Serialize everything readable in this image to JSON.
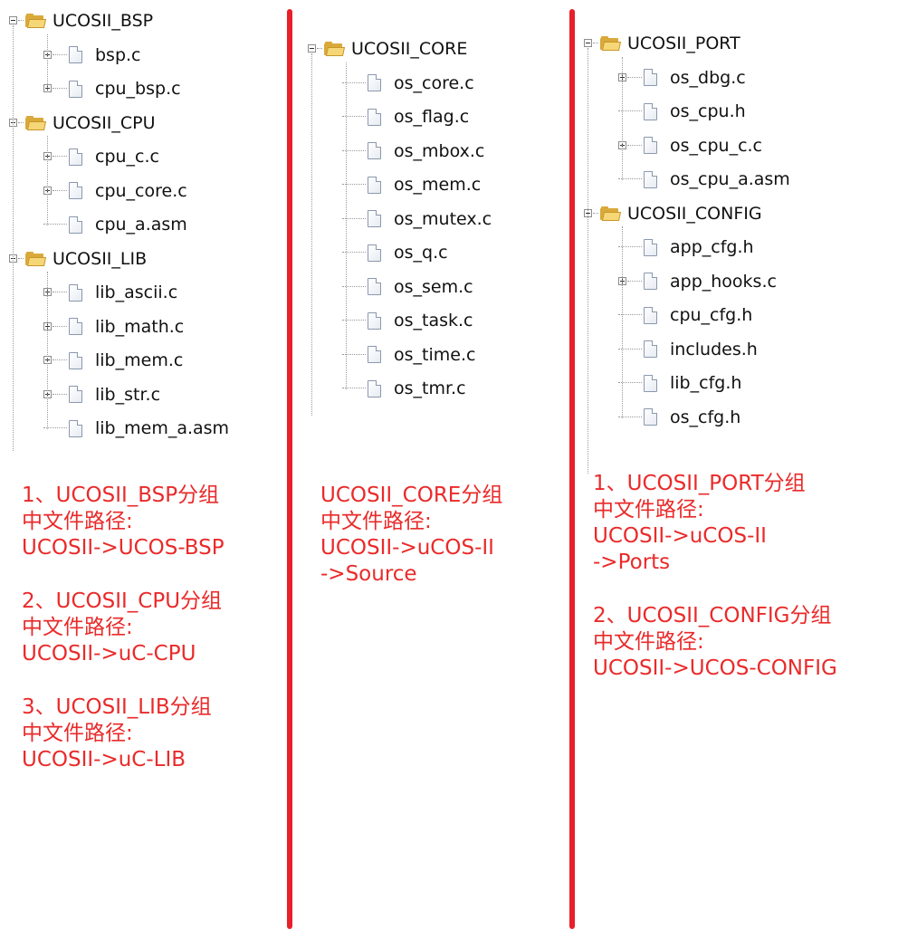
{
  "panels": [
    {
      "groups": [
        {
          "name": "UCOSII_BSP",
          "files": [
            {
              "name": "bsp.c",
              "expand": true
            },
            {
              "name": "cpu_bsp.c",
              "expand": true
            }
          ]
        },
        {
          "name": "UCOSII_CPU",
          "files": [
            {
              "name": "cpu_c.c",
              "expand": true
            },
            {
              "name": "cpu_core.c",
              "expand": true
            },
            {
              "name": "cpu_a.asm",
              "expand": false
            }
          ]
        },
        {
          "name": "UCOSII_LIB",
          "files": [
            {
              "name": "lib_ascii.c",
              "expand": true
            },
            {
              "name": "lib_math.c",
              "expand": true
            },
            {
              "name": "lib_mem.c",
              "expand": true
            },
            {
              "name": "lib_str.c",
              "expand": true
            },
            {
              "name": "lib_mem_a.asm",
              "expand": false
            }
          ]
        }
      ],
      "notes": [
        [
          "1、UCOSII_BSP分组",
          "中文件路径:",
          "UCOSII->UCOS-BSP"
        ],
        [
          "2、UCOSII_CPU分组",
          "中文件路径:",
          "UCOSII->uC-CPU"
        ],
        [
          "3、UCOSII_LIB分组",
          "中文件路径:",
          "UCOSII->uC-LIB"
        ]
      ]
    },
    {
      "groups": [
        {
          "name": "UCOSII_CORE",
          "files": [
            {
              "name": "os_core.c"
            },
            {
              "name": "os_flag.c"
            },
            {
              "name": "os_mbox.c"
            },
            {
              "name": "os_mem.c"
            },
            {
              "name": "os_mutex.c"
            },
            {
              "name": "os_q.c"
            },
            {
              "name": "os_sem.c"
            },
            {
              "name": "os_task.c"
            },
            {
              "name": "os_time.c"
            },
            {
              "name": "os_tmr.c"
            }
          ]
        }
      ],
      "notes": [
        [
          "UCOSII_CORE分组",
          "中文件路径:",
          "UCOSII->uCOS-II",
          "->Source"
        ]
      ]
    },
    {
      "groups": [
        {
          "name": "UCOSII_PORT",
          "files": [
            {
              "name": "os_dbg.c",
              "expand": true
            },
            {
              "name": "os_cpu.h",
              "expand": false
            },
            {
              "name": "os_cpu_c.c",
              "expand": true
            },
            {
              "name": "os_cpu_a.asm",
              "expand": false
            }
          ]
        },
        {
          "name": "UCOSII_CONFIG",
          "files": [
            {
              "name": "app_cfg.h",
              "expand": false
            },
            {
              "name": "app_hooks.c",
              "expand": true
            },
            {
              "name": "cpu_cfg.h",
              "expand": false
            },
            {
              "name": "includes.h",
              "expand": false
            },
            {
              "name": "lib_cfg.h",
              "expand": false
            },
            {
              "name": "os_cfg.h",
              "expand": false
            }
          ]
        }
      ],
      "notes": [
        [
          "1、UCOSII_PORT分组",
          "中文件路径:",
          "UCOSII->uCOS-II",
          "->Ports"
        ],
        [
          "2、UCOSII_CONFIG分组",
          "中文件路径:",
          "UCOSII->UCOS-CONFIG"
        ]
      ]
    }
  ],
  "colors": {
    "divider": "#e8202a",
    "note_text": "#ea2a2a",
    "folder": "#f6d777"
  }
}
